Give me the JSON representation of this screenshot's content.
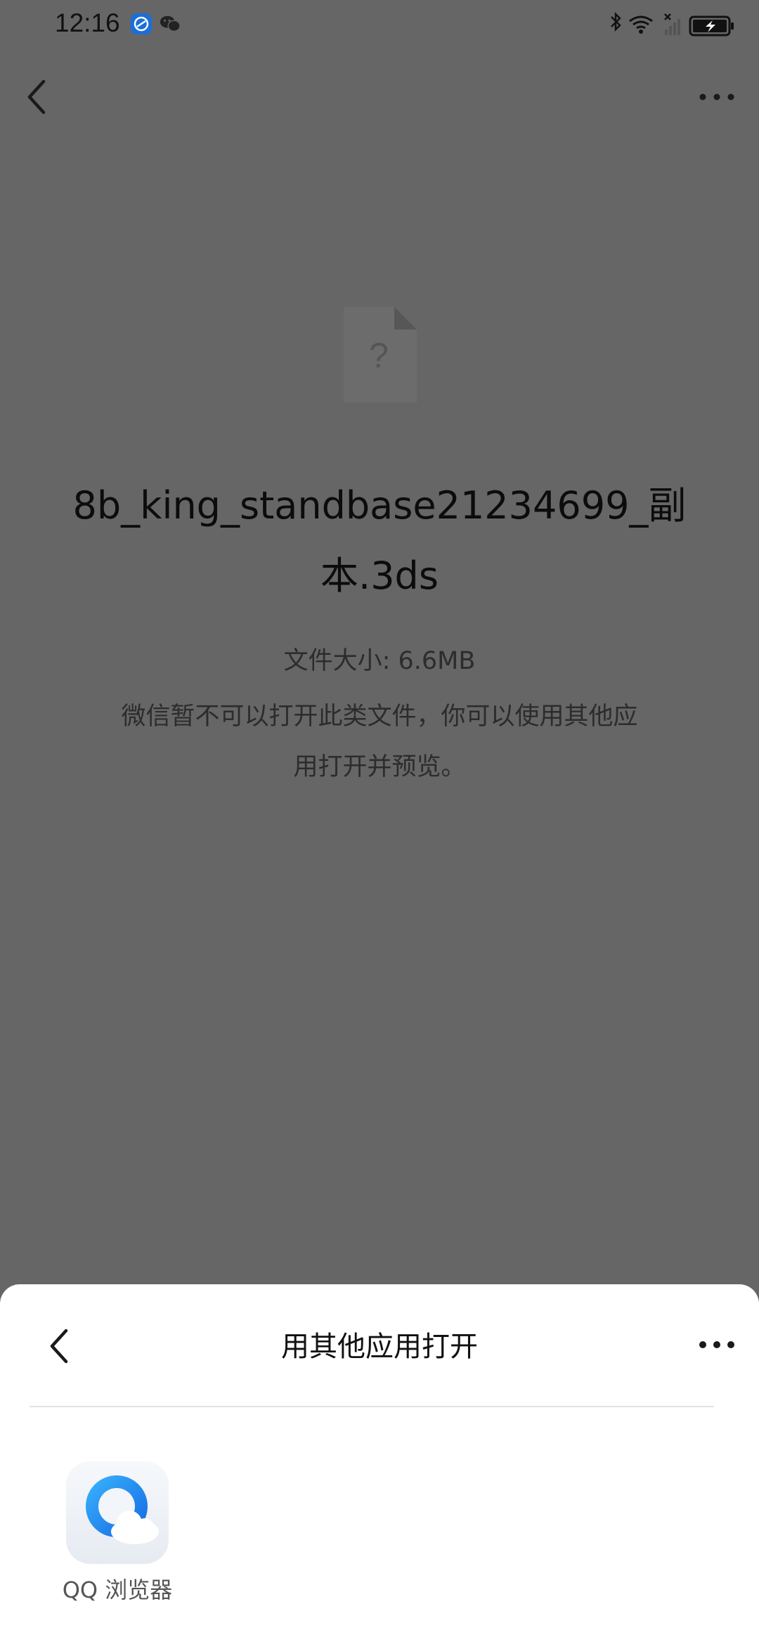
{
  "status_bar": {
    "time": "12:16",
    "icons": [
      "tracker-app-icon",
      "wechat-icon",
      "bluetooth-icon",
      "wifi-icon",
      "signal-icon",
      "battery-charging-icon"
    ]
  },
  "header": {
    "back_icon": "chevron-left-icon",
    "more_icon": "more-horizontal-icon"
  },
  "file": {
    "icon": "unknown-file-icon",
    "name": "8b_king_standbase21234699_副本.3ds",
    "size": "文件大小: 6.6MB",
    "message": "微信暂不可以打开此类文件，你可以使用其他应用打开并预览。"
  },
  "sheet": {
    "title": "用其他应用打开",
    "back_icon": "chevron-left-icon",
    "more_icon": "more-horizontal-icon",
    "apps": [
      {
        "label": "QQ 浏览器",
        "icon": "qq-browser-icon"
      }
    ]
  },
  "colors": {
    "dim_background": "#666666",
    "sheet_background": "#ffffff",
    "qq_blue": "#1e88f0"
  }
}
